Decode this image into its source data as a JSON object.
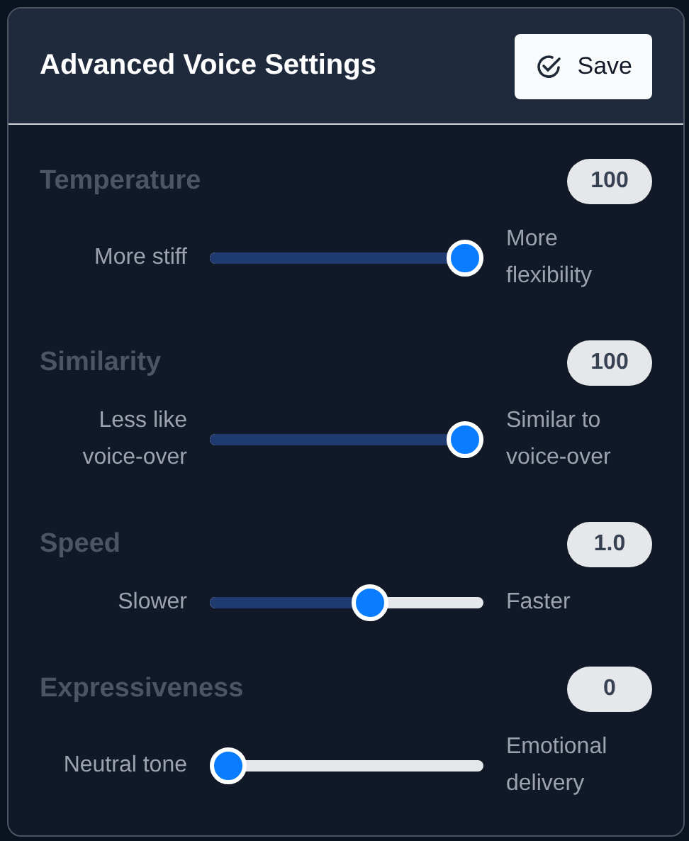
{
  "panel": {
    "title": "Advanced Voice Settings",
    "save_button": {
      "label": "Save"
    }
  },
  "settings": [
    {
      "name": "Temperature",
      "value": "100",
      "min_label": "More stiff",
      "max_label": "More flexibility",
      "level": 1
    },
    {
      "name": "Similarity",
      "value": "100",
      "min_label": "Less like voice-over",
      "max_label": "Similar to voice-over",
      "level": 1
    },
    {
      "name": "Speed",
      "value": "1.0",
      "min_label": "Slower",
      "max_label": "Faster",
      "level": 0.6
    },
    {
      "name": "Expressiveness",
      "value": "0",
      "min_label": "Neutral tone",
      "max_label": "Emotional delivery",
      "level": 0
    }
  ]
}
